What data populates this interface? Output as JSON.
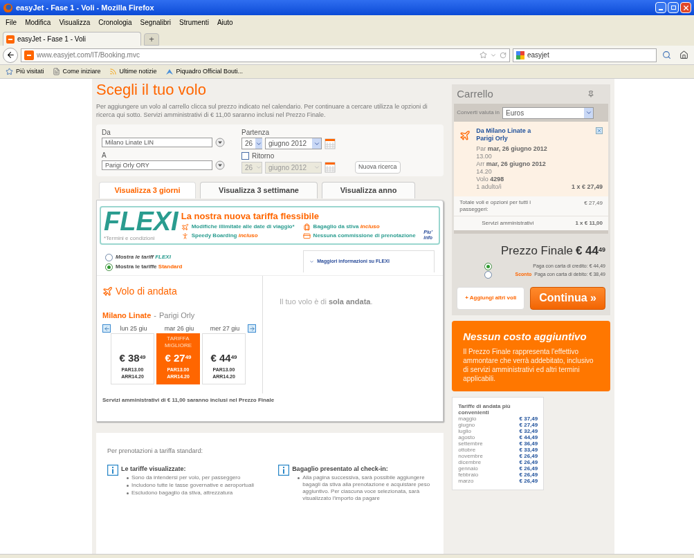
{
  "browser": {
    "title": "easyJet - Fase 1 - Voli - Mozilla Firefox",
    "menu": [
      "File",
      "Modifica",
      "Visualizza",
      "Cronologia",
      "Segnalibri",
      "Strumenti",
      "Aiuto"
    ],
    "tab_title": "easyJet - Fase 1 - Voli",
    "new_tab": "+",
    "url": "www.easyjet.com/IT/Booking.mvc",
    "search_value": "easyjet",
    "bookmarks": [
      {
        "kind": "star",
        "label": "Più visitati"
      },
      {
        "kind": "page",
        "label": "Come iniziare"
      },
      {
        "kind": "feed",
        "label": "Ultime notizie"
      },
      {
        "kind": "site",
        "label": "Piquadro Official Bouti..."
      }
    ]
  },
  "page": {
    "heading": "Scegli il tuo volo",
    "intro": "Per aggiungere un volo al carrello clicca sul prezzo indicato nel calendario. Per continuare a cercare utilizza le opzioni di ricerca qui sotto. Servizi amministrativi di € 11,00 saranno inclusi nel Prezzo Finale.",
    "search": {
      "from_label": "Da",
      "from_value": "Milano Linate LIN",
      "to_label": "A",
      "to_value": "Parigi Orly ORY",
      "departure_label": "Partenza",
      "dep_day": "26",
      "dep_month": "giugno 2012",
      "return_label": "Ritorno",
      "return_checked": false,
      "return_disabled": true,
      "ret_day": "26",
      "ret_month": "giugno 2012",
      "new_search": "Nuova ricerca"
    },
    "view_tabs": [
      {
        "label": "Visualizza 3 giorni",
        "selected": true
      },
      {
        "label": "Visualizza 3 settimane",
        "selected": false
      },
      {
        "label": "Visualizza anno",
        "selected": false
      }
    ],
    "flexi": {
      "logo": "FLEXI",
      "terms": "*Termini e condizioni",
      "headline": "La nostra nuova tariffa flessibile",
      "more": "Piu' info",
      "features": [
        {
          "kind": "plane",
          "text": "Modifiche illimitate alle date di viaggio*"
        },
        {
          "kind": "bag",
          "text": "Bagaglio da stiva *incluso*"
        },
        {
          "kind": "runner",
          "text": "Speedy Boarding *incluso*"
        },
        {
          "kind": "card",
          "text": "Nessuna commissione di prenotazione"
        }
      ]
    },
    "fare_options": [
      {
        "prefix": "Mostra le tariff",
        "highlight": "FLEXI",
        "color": "#2a9c8f",
        "italic": true,
        "selected": false
      },
      {
        "prefix": "Mostra le tariffe",
        "highlight": "Standard",
        "color": "#ff6600",
        "italic": false,
        "selected": true
      }
    ],
    "more_info_link": "Maggiori informazioni su FLEXI",
    "outbound": {
      "title": "Volo di andata",
      "origin": "Milano Linate",
      "separator": "-",
      "destination": "Parigi Orly",
      "days": [
        {
          "label": "lun 25 giu",
          "price": "€ 38$^{49}$",
          "dep": "PAR13.00",
          "arr": "ARR14.20",
          "selected": false
        },
        {
          "label": "mar 26 giu",
          "badge": "TARIFFA MIGLIORE",
          "price": "€ 27$^{49}$",
          "dep": "PAR13.00",
          "arr": "ARR14.20",
          "selected": true
        },
        {
          "label": "mer 27 giu",
          "price": "€ 44$^{49}$",
          "dep": "PAR13.00",
          "arr": "ARR14.20",
          "selected": false
        }
      ]
    },
    "return_note": "Il tuo volo è di **sola andata**.",
    "footnote": "Servizi amministrativi di € 11,00 saranno inclusi nel Prezzo Finale",
    "info": {
      "intro": "Per prenotazioni a tariffa standard:",
      "columns": [
        {
          "title": "Le tariffe visualizzate:",
          "bullets": [
            "Sono da intendersi per volo, per passeggero",
            "Includono tutte le tasse governative e aeroportuali",
            "Escludono bagaglio da stiva, attrezzatura"
          ]
        },
        {
          "title": "Bagaglio presentato al check-in:",
          "bullets": [
            "Alla pagina successiva, sarà possibile aggiungere bagagli da stiva alla prenotazione e acquistare peso aggiuntivo. Per ciascuna voce selezionata, sarà visualizzato l'importo da pagare"
          ]
        }
      ]
    }
  },
  "cart": {
    "title": "Carrello",
    "currency_label": "Converti valuta in",
    "currency": "Euros",
    "item": {
      "title": "Da Milano Linate a Parigi Orly",
      "dep_label": "Par",
      "dep_date": "mar, 26 giugno 2012",
      "dep_time": "13.00",
      "arr_label": "Arr",
      "arr_date": "mar, 26 giugno 2012",
      "arr_time": "14.20",
      "flight_label": "Volo",
      "flight_no": "4298",
      "pax": "1 adulto/i",
      "price": "1 x € 27,49"
    },
    "total_label": "Totale voli e opzioni per tutti i passeggeri:",
    "total": "€ 27,49",
    "fee_label": "Servizi amministrativi",
    "fee": "1 x € 11,00",
    "final_label": "Prezzo Finale",
    "final_price": "€ 44$^{49}$",
    "payments": [
      {
        "label": "Paga con carta di credito: € 44,49",
        "selected": true
      },
      {
        "discount": "Sconto",
        "label": "Paga con carta di debito: € 38,49",
        "selected": false
      }
    ],
    "add_button": "+ Aggiungi altri voli",
    "continue_button": "Continua »"
  },
  "promo": {
    "title": "Nessun costo aggiuntivo",
    "text": "Il Prezzo Finale rappresenta l'effettivo ammontare che verrà addebitato, inclusivo di servizi amministrativi ed altri termini applicabili."
  },
  "fares": {
    "title": "Tariffe di andata più convenienti",
    "rows": [
      {
        "month": "maggio",
        "price": "€ 37,49"
      },
      {
        "month": "giugno",
        "price": "€ 27,49"
      },
      {
        "month": "luglio",
        "price": "€ 32,49"
      },
      {
        "month": "agosto",
        "price": "€ 44,49"
      },
      {
        "month": "settembre",
        "price": "€ 36,49"
      },
      {
        "month": "ottobre",
        "price": "€ 33,49"
      },
      {
        "month": "novembre",
        "price": "€ 26,49"
      },
      {
        "month": "dicembre",
        "price": "€ 26,49"
      },
      {
        "month": "gennaio",
        "price": "€ 26,49"
      },
      {
        "month": "febbraio",
        "price": "€ 26,49"
      },
      {
        "month": "marzo",
        "price": "€ 26,49"
      }
    ]
  }
}
